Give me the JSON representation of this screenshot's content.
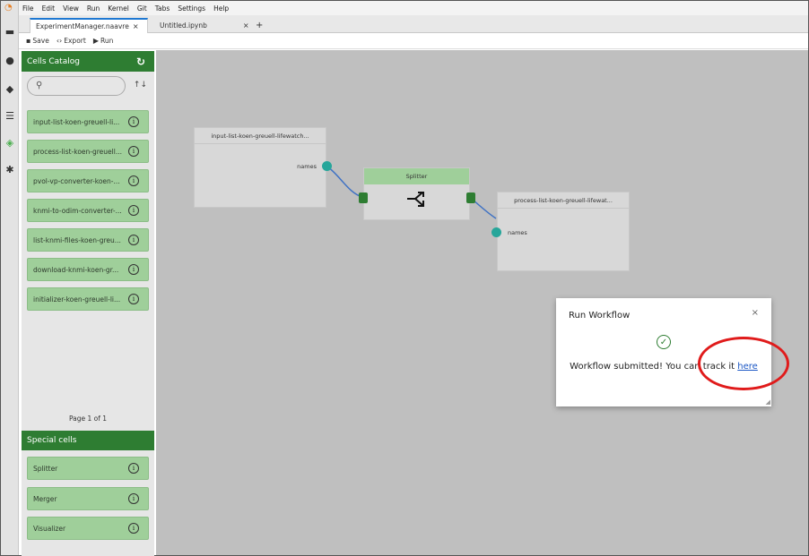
{
  "menu": [
    "File",
    "Edit",
    "View",
    "Run",
    "Kernel",
    "Git",
    "Tabs",
    "Settings",
    "Help"
  ],
  "tabs": [
    {
      "label": "ExperimentManager.naavre",
      "close": "×"
    },
    {
      "label": "Untitled.ipynb",
      "close": "×"
    },
    {
      "label": "+"
    }
  ],
  "toolbar": {
    "save": "Save",
    "export": "Export",
    "run": "Run"
  },
  "catalog": {
    "title": "Cells Catalog",
    "items": [
      "input-list-koen-greuell-li...",
      "process-list-koen-greuell...",
      "pvol-vp-converter-koen-...",
      "knmi-to-odim-converter-...",
      "list-knmi-files-koen-greu...",
      "download-knmi-koen-gr...",
      "initializer-koen-greuell-li..."
    ],
    "pager": "Page 1 of 1",
    "special_title": "Special cells",
    "special_items": [
      "Splitter",
      "Merger",
      "Visualizer"
    ],
    "info_glyph": "i"
  },
  "canvas": {
    "node1": {
      "title": "input-list-koen-greuell-lifewatch...",
      "port": "names"
    },
    "splitter": {
      "title": "Splitter"
    },
    "node2": {
      "title": "process-list-koen-greuell-lifewat...",
      "port": "names"
    }
  },
  "modal": {
    "title": "Run Workflow",
    "close": "×",
    "message": "Workflow submitted! You can track it ",
    "link": "here"
  },
  "colors": {
    "accent_green": "#2e7d32",
    "cell_green": "#9fcf9a",
    "port_teal": "#26a69a",
    "annotation_red": "#e01b1b",
    "link_blue": "#1a56c4"
  }
}
